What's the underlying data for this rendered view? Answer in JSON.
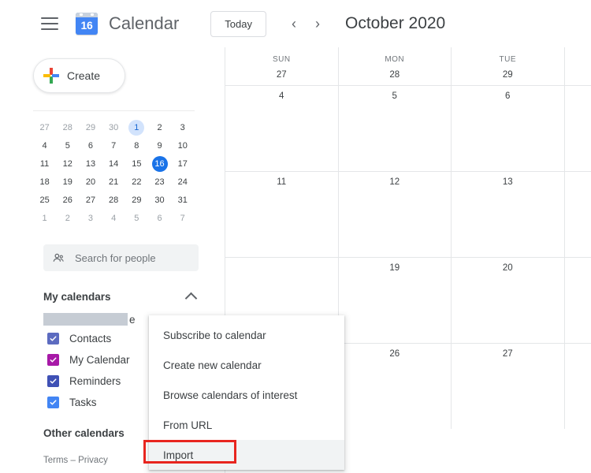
{
  "header": {
    "menu_icon": "hamburger-icon",
    "app_icon_number": "16",
    "app_title": "Calendar",
    "today_label": "Today",
    "prev_icon": "chevron-left-icon",
    "next_icon": "chevron-right-icon",
    "prev_glyph": "‹",
    "next_glyph": "›",
    "month_title": "October 2020"
  },
  "sidebar": {
    "create_label": "Create",
    "create_icon": "google-plus-icon",
    "mini_calendar": {
      "rows": [
        [
          {
            "d": "27",
            "muted": true
          },
          {
            "d": "28",
            "muted": true
          },
          {
            "d": "29",
            "muted": true
          },
          {
            "d": "30",
            "muted": true
          },
          {
            "d": "1",
            "muted": false,
            "state": "soft"
          },
          {
            "d": "2",
            "muted": false
          },
          {
            "d": "3",
            "muted": false
          }
        ],
        [
          {
            "d": "4",
            "muted": false
          },
          {
            "d": "5",
            "muted": false
          },
          {
            "d": "6",
            "muted": false
          },
          {
            "d": "7",
            "muted": false
          },
          {
            "d": "8",
            "muted": false
          },
          {
            "d": "9",
            "muted": false
          },
          {
            "d": "10",
            "muted": false
          }
        ],
        [
          {
            "d": "11",
            "muted": false
          },
          {
            "d": "12",
            "muted": false
          },
          {
            "d": "13",
            "muted": false
          },
          {
            "d": "14",
            "muted": false
          },
          {
            "d": "15",
            "muted": false
          },
          {
            "d": "16",
            "muted": false,
            "state": "solid"
          },
          {
            "d": "17",
            "muted": false
          }
        ],
        [
          {
            "d": "18",
            "muted": false
          },
          {
            "d": "19",
            "muted": false
          },
          {
            "d": "20",
            "muted": false
          },
          {
            "d": "21",
            "muted": false
          },
          {
            "d": "22",
            "muted": false
          },
          {
            "d": "23",
            "muted": false
          },
          {
            "d": "24",
            "muted": false
          }
        ],
        [
          {
            "d": "25",
            "muted": false
          },
          {
            "d": "26",
            "muted": false
          },
          {
            "d": "27",
            "muted": false
          },
          {
            "d": "28",
            "muted": false
          },
          {
            "d": "29",
            "muted": false
          },
          {
            "d": "30",
            "muted": false
          },
          {
            "d": "31",
            "muted": false
          }
        ],
        [
          {
            "d": "1",
            "muted": true
          },
          {
            "d": "2",
            "muted": true
          },
          {
            "d": "3",
            "muted": true
          },
          {
            "d": "4",
            "muted": true
          },
          {
            "d": "5",
            "muted": true
          },
          {
            "d": "6",
            "muted": true
          },
          {
            "d": "7",
            "muted": true
          }
        ]
      ],
      "today_color": "#1a73e8",
      "selected_color": "#d2e3fc"
    },
    "search_people": {
      "icon": "people-icon",
      "placeholder": "Search for people"
    },
    "my_calendars": {
      "title": "My calendars",
      "collapse_icon": "chevron-up-icon",
      "redacted_tail": "e",
      "items": [
        {
          "label": "Contacts",
          "color": "#5c6bc0",
          "checked": true
        },
        {
          "label": "My Calendar",
          "color": "#a719a7",
          "checked": true
        },
        {
          "label": "Reminders",
          "color": "#3f51b5",
          "checked": true
        },
        {
          "label": "Tasks",
          "color": "#4285f4",
          "checked": true
        }
      ]
    },
    "other_calendars": {
      "title": "Other calendars"
    },
    "footer": {
      "terms": "Terms",
      "separator": "–",
      "privacy": "Privacy"
    }
  },
  "grid": {
    "columns": [
      {
        "dow": "SUN",
        "date": "27"
      },
      {
        "dow": "MON",
        "date": "28"
      },
      {
        "dow": "TUE",
        "date": "29"
      }
    ],
    "weeks": [
      [
        "4",
        "5",
        "6"
      ],
      [
        "11",
        "12",
        "13"
      ],
      [
        "",
        "19",
        "20"
      ],
      [
        "",
        "26",
        "27"
      ]
    ]
  },
  "context_menu": {
    "items": [
      {
        "label": "Subscribe to calendar",
        "hovered": false
      },
      {
        "label": "Create new calendar",
        "hovered": false
      },
      {
        "label": "Browse calendars of interest",
        "hovered": false
      },
      {
        "label": "From URL",
        "hovered": false
      },
      {
        "label": "Import",
        "hovered": true
      }
    ]
  },
  "annotation": {
    "target": "Import",
    "color": "#e8251f"
  }
}
